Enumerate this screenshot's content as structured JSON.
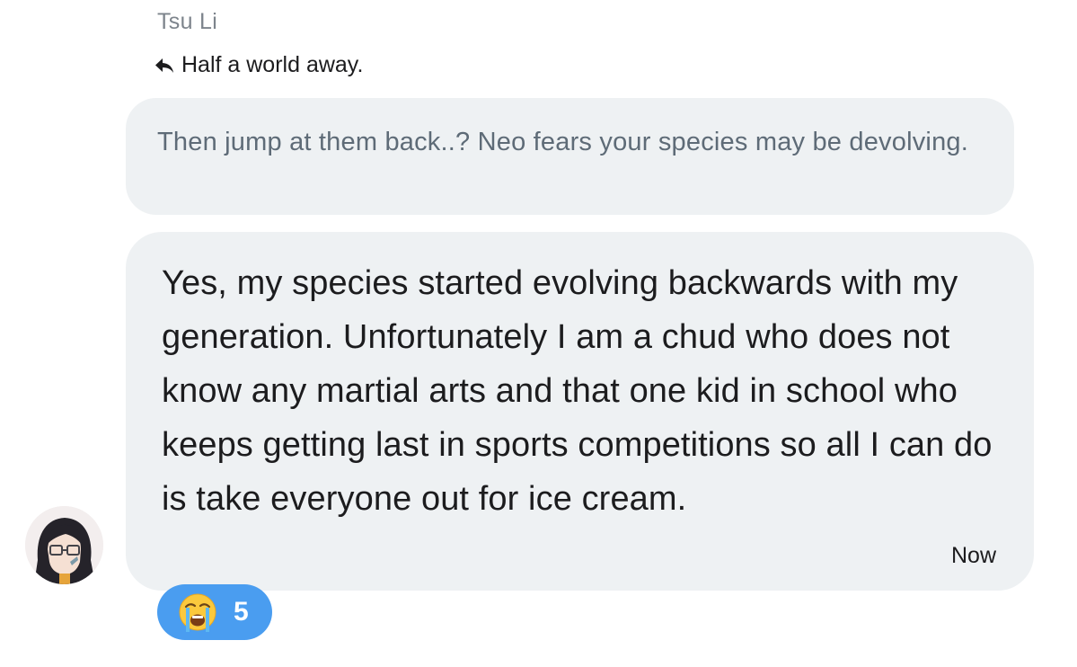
{
  "sender": {
    "name": "Tsu Li"
  },
  "reply": {
    "icon": "reply-arrow-icon",
    "quoted_excerpt": "Half a world away."
  },
  "quoted_message": {
    "text": "Then jump at them back..? Neo fears your species may be devolving."
  },
  "message": {
    "text": "Yes, my species started evolving backwards with my generation. Unfortunately I am a chud who does not know any martial arts and that one kid in school who keeps getting last in sports competitions so all I can do is take everyone out for ice cream.",
    "timestamp": "Now"
  },
  "reactions": [
    {
      "emoji": "loudly-crying-face-emoji",
      "count": "5"
    }
  ],
  "colors": {
    "bubble": "#eef1f3",
    "reaction_pill": "#4a9df0",
    "secondary_text": "#7d848c",
    "quoted_text": "#5e6b77"
  }
}
